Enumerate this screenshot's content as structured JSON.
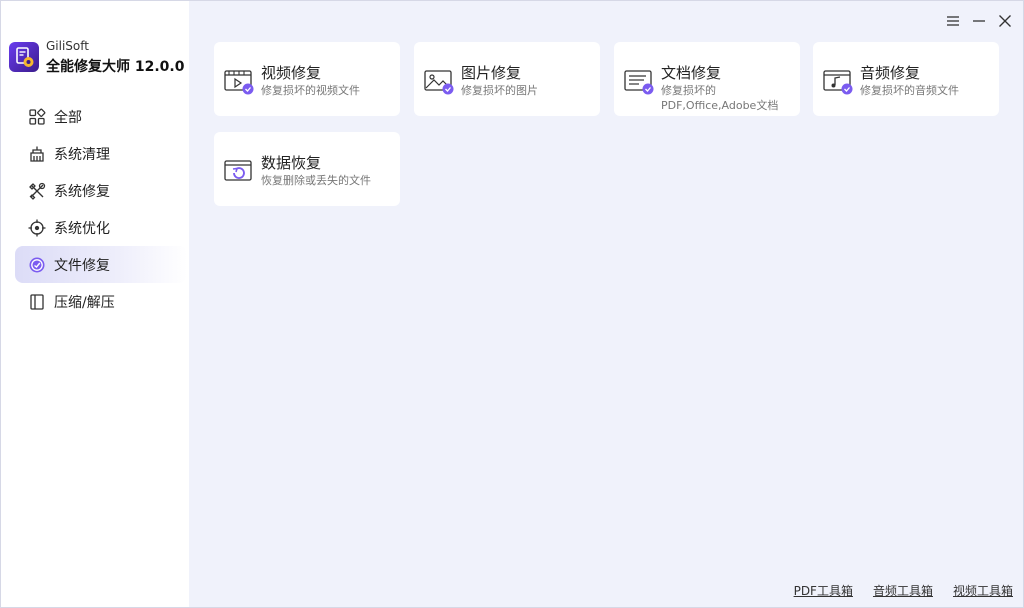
{
  "app": {
    "company": "GiliSoft",
    "product": "全能修复大师 12.0.0"
  },
  "sidebar": {
    "items": [
      {
        "label": "全部",
        "icon": "grid-icon",
        "active": false
      },
      {
        "label": "系统清理",
        "icon": "broom-icon",
        "active": false
      },
      {
        "label": "系统修复",
        "icon": "tools-icon",
        "active": false
      },
      {
        "label": "系统优化",
        "icon": "target-icon",
        "active": false
      },
      {
        "label": "文件修复",
        "icon": "file-repair-icon",
        "active": true
      },
      {
        "label": "压缩/解压",
        "icon": "archive-icon",
        "active": false
      }
    ]
  },
  "window_controls": {
    "menu": "menu-icon",
    "minimize": "minimize-icon",
    "close": "close-icon"
  },
  "cards": [
    {
      "title": "视频修复",
      "desc": "修复损坏的视频文件",
      "icon": "video-repair-icon"
    },
    {
      "title": "图片修复",
      "desc": "修复损坏的图片",
      "icon": "image-repair-icon"
    },
    {
      "title": "文档修复",
      "desc": "修复损坏的PDF,Office,Adobe文档",
      "icon": "document-repair-icon"
    },
    {
      "title": "音频修复",
      "desc": "修复损坏的音频文件",
      "icon": "audio-repair-icon"
    },
    {
      "title": "数据恢复",
      "desc": "恢复删除或丢失的文件",
      "icon": "data-recovery-icon"
    }
  ],
  "footer": {
    "pdf_tools": "PDF工具箱",
    "audio_tools": "音频工具箱",
    "video_tools": "视频工具箱"
  },
  "colors": {
    "accent": "#6c4ff0",
    "sidebar_active": "#dcdcf7",
    "content_bg": "#f0f2fb"
  }
}
